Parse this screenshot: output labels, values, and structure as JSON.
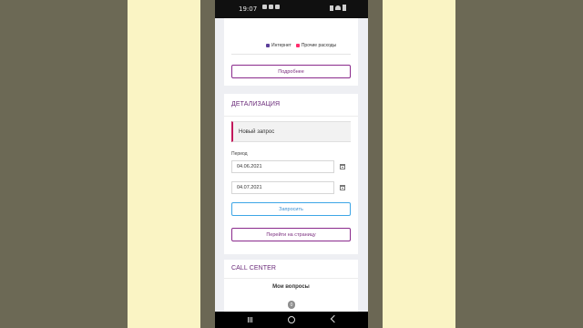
{
  "status_bar": {
    "time": "19:07"
  },
  "expenses_chart": {
    "colors": {
      "internet": "#5c3f9a",
      "other": "#ff2d6d"
    },
    "legend": [
      {
        "label": "Интернет",
        "color": "#5c3f9a"
      },
      {
        "label": "Прочие расходы",
        "color": "#ff2d6d"
      }
    ],
    "details_button": "Подробнее"
  },
  "details": {
    "title": "ДЕТАЛИЗАЦИЯ",
    "new_request": "Новый запрос",
    "period_label": "Период",
    "date_from": "04.06.2021",
    "date_to": "04.07.2021",
    "request_button": "Запросить",
    "goto_page_button": "Перейти на страницу"
  },
  "call_center": {
    "title": "CALL CENTER",
    "my_questions": "Мои вопросы"
  },
  "scroll_indicator": "0"
}
